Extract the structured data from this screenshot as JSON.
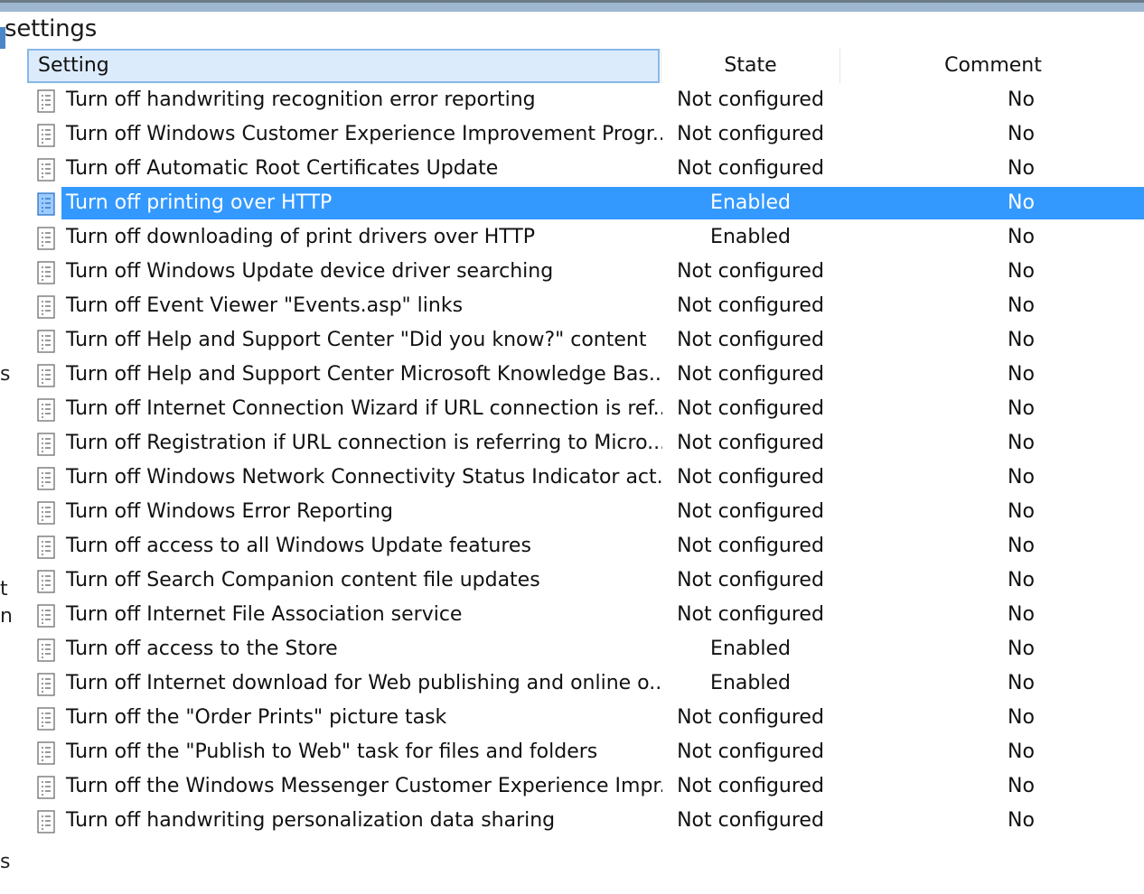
{
  "pane": {
    "title": "settings"
  },
  "left_fragments": [
    "s",
    "t",
    "n",
    "s"
  ],
  "columns": {
    "setting": "Setting",
    "state": "State",
    "comment": "Comment"
  },
  "rows": [
    {
      "name": "Turn off handwriting recognition error reporting",
      "state": "Not configured",
      "comment": "No"
    },
    {
      "name": "Turn off Windows Customer Experience Improvement Progr...",
      "state": "Not configured",
      "comment": "No"
    },
    {
      "name": "Turn off Automatic Root Certificates Update",
      "state": "Not configured",
      "comment": "No"
    },
    {
      "name": "Turn off printing over HTTP",
      "state": "Enabled",
      "comment": "No",
      "selected": true
    },
    {
      "name": "Turn off downloading of print drivers over HTTP",
      "state": "Enabled",
      "comment": "No"
    },
    {
      "name": "Turn off Windows Update device driver searching",
      "state": "Not configured",
      "comment": "No"
    },
    {
      "name": "Turn off Event Viewer \"Events.asp\" links",
      "state": "Not configured",
      "comment": "No"
    },
    {
      "name": "Turn off Help and Support Center \"Did you know?\" content",
      "state": "Not configured",
      "comment": "No"
    },
    {
      "name": "Turn off Help and Support Center Microsoft Knowledge Bas...",
      "state": "Not configured",
      "comment": "No"
    },
    {
      "name": "Turn off Internet Connection Wizard if URL connection is ref...",
      "state": "Not configured",
      "comment": "No"
    },
    {
      "name": "Turn off Registration if URL connection is referring to Micro...",
      "state": "Not configured",
      "comment": "No"
    },
    {
      "name": "Turn off Windows Network Connectivity Status Indicator act...",
      "state": "Not configured",
      "comment": "No"
    },
    {
      "name": "Turn off Windows Error Reporting",
      "state": "Not configured",
      "comment": "No"
    },
    {
      "name": "Turn off access to all Windows Update features",
      "state": "Not configured",
      "comment": "No"
    },
    {
      "name": "Turn off Search Companion content file updates",
      "state": "Not configured",
      "comment": "No"
    },
    {
      "name": "Turn off Internet File Association service",
      "state": "Not configured",
      "comment": "No"
    },
    {
      "name": "Turn off access to the Store",
      "state": "Enabled",
      "comment": "No"
    },
    {
      "name": "Turn off Internet download for Web publishing and online o...",
      "state": "Enabled",
      "comment": "No"
    },
    {
      "name": "Turn off the \"Order Prints\" picture task",
      "state": "Not configured",
      "comment": "No"
    },
    {
      "name": "Turn off the \"Publish to Web\" task for files and folders",
      "state": "Not configured",
      "comment": "No"
    },
    {
      "name": "Turn off the Windows Messenger Customer Experience Impr...",
      "state": "Not configured",
      "comment": "No"
    },
    {
      "name": "Turn off handwriting personalization data sharing",
      "state": "Not configured",
      "comment": "No"
    }
  ],
  "icons": {
    "row_icon": "policy-setting-icon"
  },
  "colors": {
    "selection": "#3399ff",
    "header_active": "#dcebfc",
    "titlebar": "#a4bbd3"
  }
}
